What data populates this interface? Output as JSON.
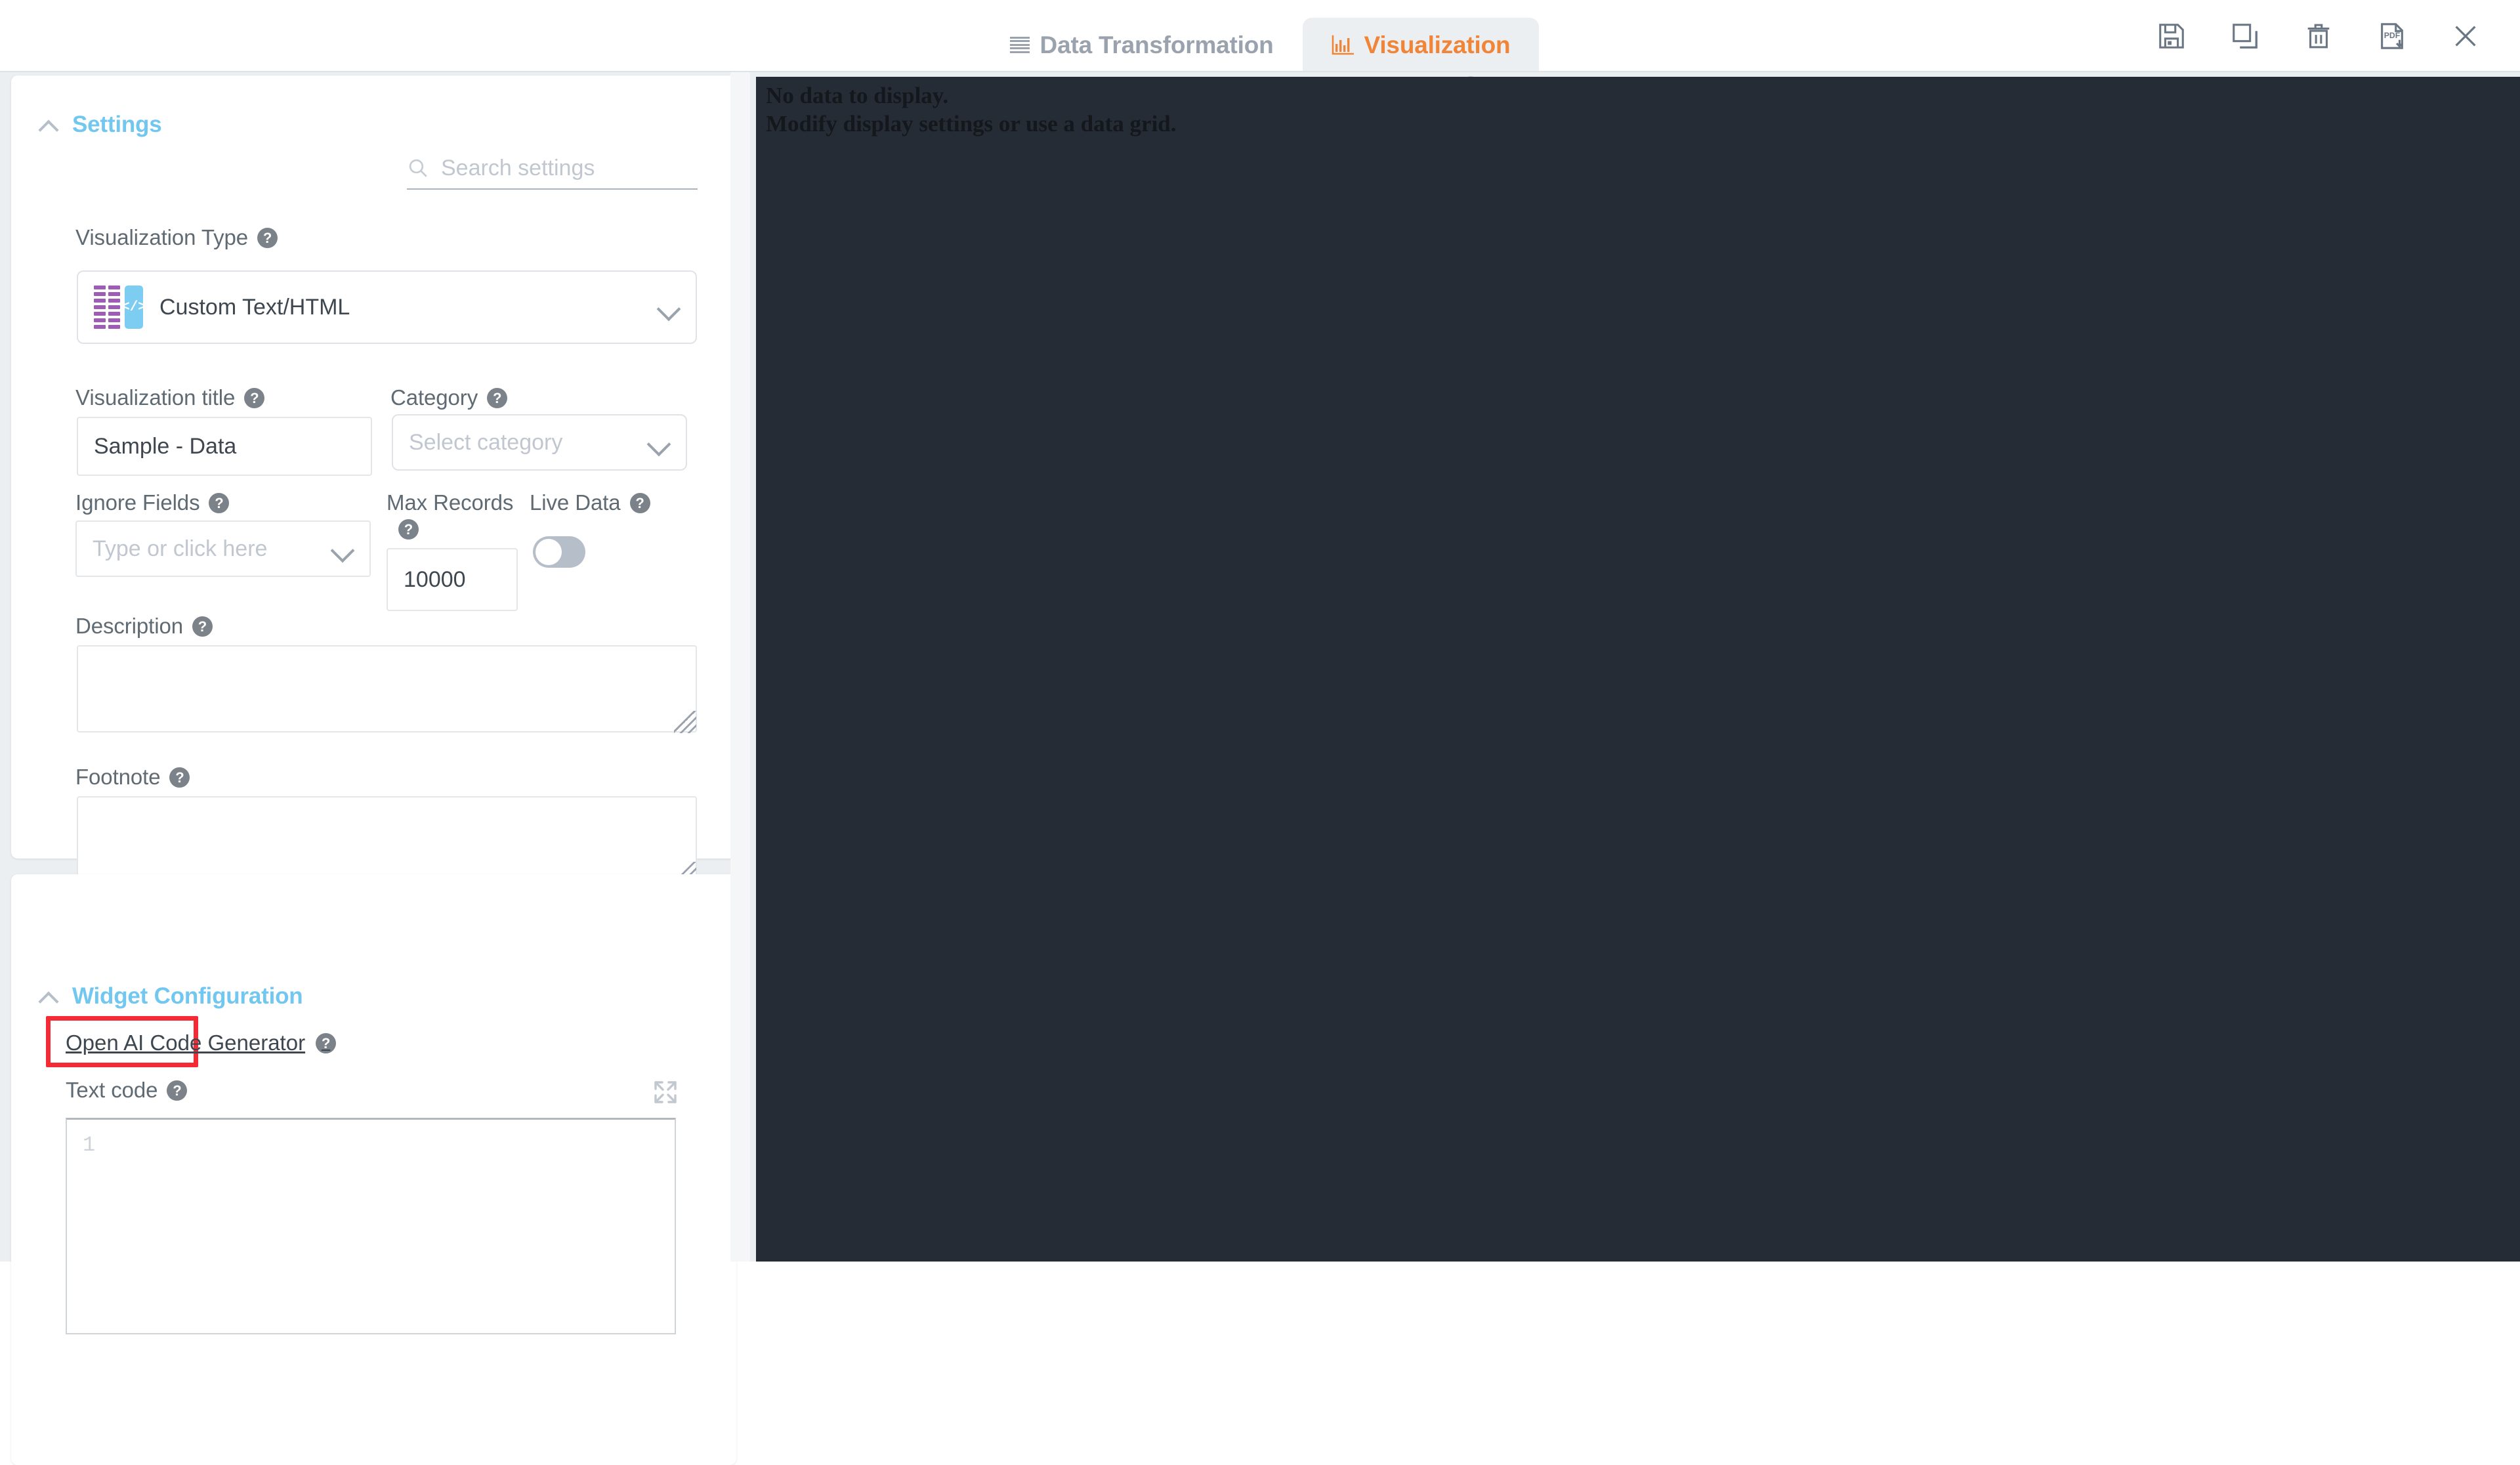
{
  "tabs": [
    {
      "id": "data-transformation",
      "label": "Data Transformation",
      "icon": "grid-icon",
      "active": false
    },
    {
      "id": "visualization",
      "label": "Visualization",
      "icon": "bar-chart-icon",
      "active": true
    }
  ],
  "toolbar": {
    "save_label": "save-icon",
    "duplicate_label": "duplicate-icon",
    "delete_label": "trash-icon",
    "pdf_label": "pdf-download-icon",
    "close_label": "close-icon"
  },
  "settings": {
    "section_title": "Settings",
    "search": {
      "placeholder": "Search settings",
      "value": ""
    },
    "viz_type": {
      "label": "Visualization Type",
      "value": "Custom Text/HTML",
      "icon_code": "</>"
    },
    "viz_title": {
      "label": "Visualization title",
      "value": "Sample - Data"
    },
    "category": {
      "label": "Category",
      "placeholder": "Select category",
      "value": ""
    },
    "ignore_fields": {
      "label": "Ignore Fields",
      "placeholder": "Type or click here",
      "value": ""
    },
    "max_records": {
      "label": "Max Records",
      "value": "10000"
    },
    "live_data": {
      "label": "Live Data",
      "state": "off"
    },
    "description": {
      "label": "Description",
      "value": ""
    },
    "footnote": {
      "label": "Footnote",
      "value": ""
    }
  },
  "widget_configuration": {
    "section_title": "Widget Configuration",
    "ai_code_generator": {
      "label": "Open AI Code Generator"
    },
    "text_code": {
      "label": "Text code",
      "line_number": "1",
      "value": ""
    }
  },
  "preview": {
    "message": "No data to display.\nModify display settings or use a data grid."
  },
  "colors": {
    "accent_orange": "#f08437",
    "section_blue": "#72c7f0",
    "highlight_red": "#f42b35",
    "panel_dark": "#262c35",
    "page_bg": "#eceff1"
  }
}
